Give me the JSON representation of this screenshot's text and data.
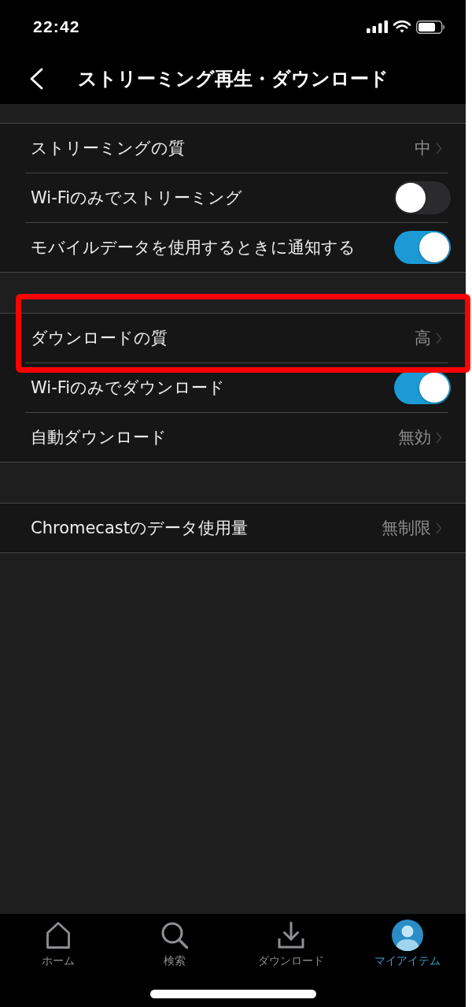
{
  "status_bar": {
    "time": "22:42"
  },
  "nav_bar": {
    "title": "ストリーミング再生・ダウンロード"
  },
  "sections": [
    {
      "rows": [
        {
          "kind": "value",
          "label": "ストリーミングの質",
          "value": "中",
          "highlighted": false
        },
        {
          "kind": "toggle",
          "label": "Wi-Fiのみでストリーミング",
          "on": false,
          "highlighted": false
        },
        {
          "kind": "toggle",
          "label": "モバイルデータを使用するときに通知する",
          "on": true,
          "highlighted": false
        }
      ]
    },
    {
      "rows": [
        {
          "kind": "value",
          "label": "ダウンロードの質",
          "value": "高",
          "highlighted": true
        },
        {
          "kind": "toggle",
          "label": "Wi-Fiのみでダウンロード",
          "on": true,
          "highlighted": false
        },
        {
          "kind": "value",
          "label": "自動ダウンロード",
          "value": "無効",
          "highlighted": false
        }
      ]
    },
    {
      "rows": [
        {
          "kind": "value",
          "label": "Chromecastのデータ使用量",
          "value": "無制限",
          "highlighted": false
        }
      ]
    }
  ],
  "tab_bar": {
    "tabs": [
      {
        "label": "ホーム",
        "selected": false
      },
      {
        "label": "検索",
        "selected": false
      },
      {
        "label": "ダウンロード",
        "selected": false
      },
      {
        "label": "マイアイテム",
        "selected": true
      }
    ]
  }
}
